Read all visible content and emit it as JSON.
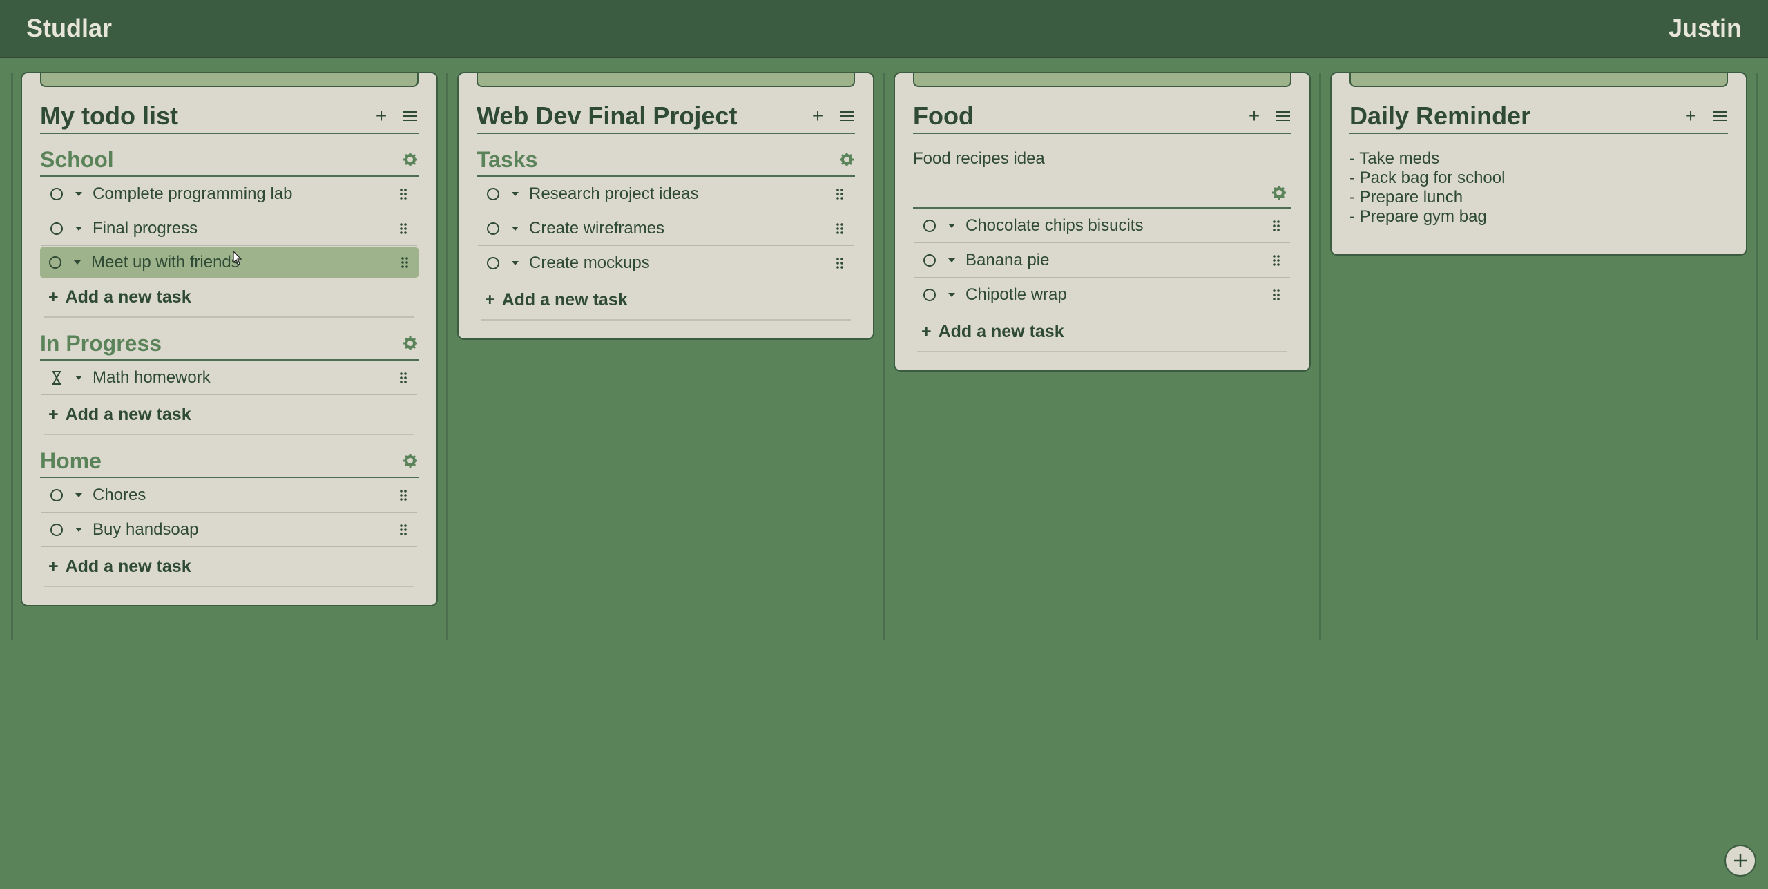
{
  "app": {
    "brand": "Studlar",
    "user": "Justin"
  },
  "colors": {
    "background": "#5a8359",
    "topbar": "#3c5c41",
    "card": "#dbd9ce",
    "accent": "#9eb38b",
    "section_title": "#5a8359"
  },
  "cards": [
    {
      "title": "My todo list",
      "sections": [
        {
          "title": "School",
          "tasks": [
            {
              "label": "Complete programming lab",
              "status": "todo"
            },
            {
              "label": "Final progress",
              "status": "todo"
            },
            {
              "label": "Meet up with friends",
              "status": "todo",
              "hovered": true
            }
          ],
          "add_label": "Add a new task"
        },
        {
          "title": "In Progress",
          "tasks": [
            {
              "label": "Math homework",
              "status": "in-progress"
            }
          ],
          "add_label": "Add a new task"
        },
        {
          "title": "Home",
          "tasks": [
            {
              "label": "Chores",
              "status": "todo"
            },
            {
              "label": "Buy handsoap",
              "status": "todo"
            }
          ],
          "add_label": "Add a new task"
        }
      ]
    },
    {
      "title": "Web Dev Final Project",
      "sections": [
        {
          "title": "Tasks",
          "tasks": [
            {
              "label": "Research project ideas",
              "status": "todo"
            },
            {
              "label": "Create wireframes",
              "status": "todo"
            },
            {
              "label": "Create mockups",
              "status": "todo"
            }
          ],
          "add_label": "Add a new task"
        }
      ]
    },
    {
      "title": "Food",
      "description": "Food recipes idea",
      "tasks": [
        {
          "label": "Chocolate chips bisucits",
          "status": "todo"
        },
        {
          "label": "Banana pie",
          "status": "todo"
        },
        {
          "label": "Chipotle wrap",
          "status": "todo"
        }
      ],
      "add_label": "Add a new task"
    },
    {
      "title": "Daily Reminder",
      "description": "- Take meds\n- Pack bag for school\n- Prepare lunch\n- Prepare gym bag"
    }
  ],
  "icons": {
    "add": "plus-icon",
    "menu": "hamburger-menu-icon",
    "settings": "gear-icon",
    "drag": "drag-handle-icon",
    "status_todo": "circle-icon",
    "status_in_progress": "hourglass-icon",
    "expand": "caret-down-icon",
    "fab": "plus-circle-icon"
  }
}
